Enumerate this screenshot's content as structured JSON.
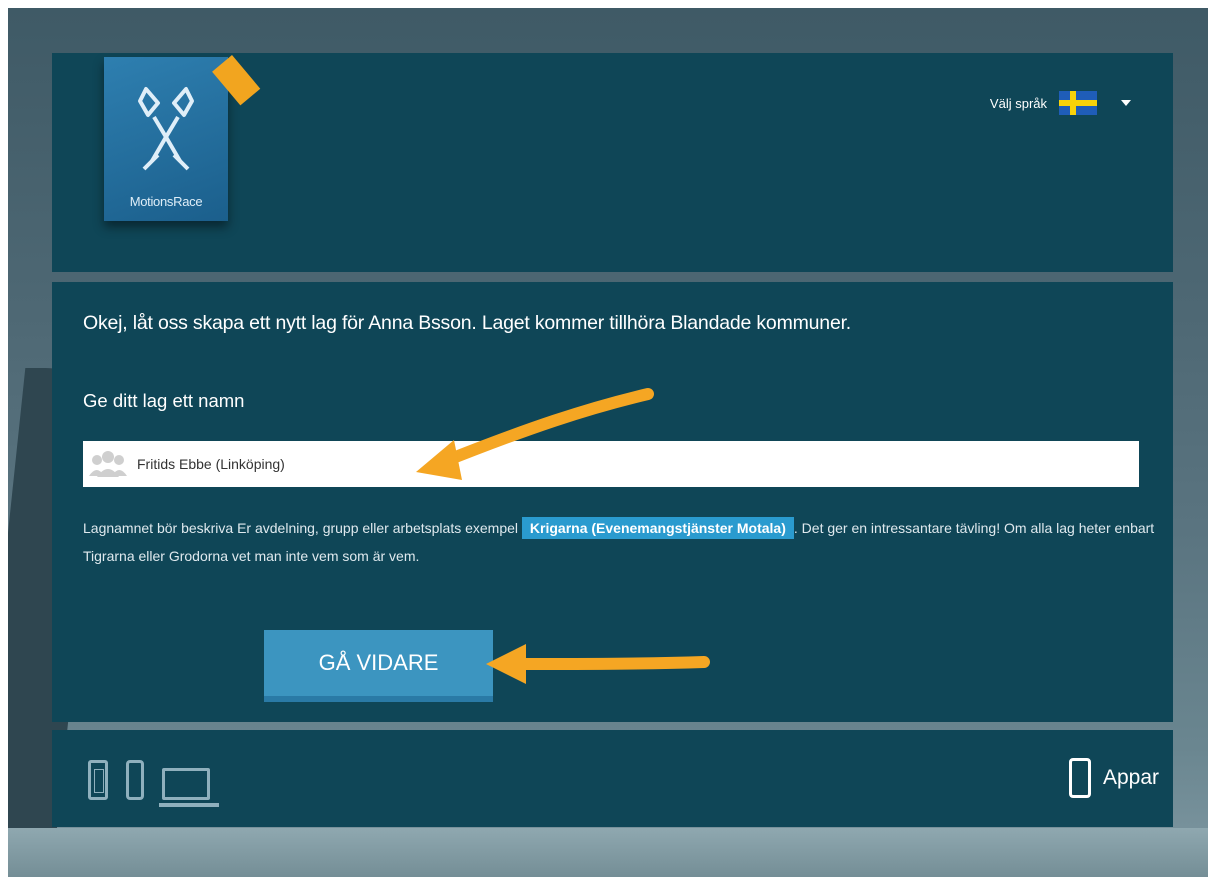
{
  "logo": {
    "text": "MotionsRace"
  },
  "language": {
    "label": "Välj språk",
    "flag_icon": "sweden-flag-icon",
    "dropdown_icon": "caret-down-icon"
  },
  "intro": "Okej, låt oss skapa ett nytt lag för Anna Bsson. Laget kommer tillhöra Blandade kommuner.",
  "team_name": {
    "label": "Ge ditt lag ett namn",
    "value": "Fritids Ebbe (Linköping)",
    "icon": "group-icon"
  },
  "hint": {
    "prefix": "Lagnamnet bör beskriva Er avdelning, grupp eller arbetsplats exempel",
    "example": "Krigarna (Evenemangstjänster Motala)",
    "suffix": ". Det ger en intressantare tävling! Om alla lag heter enbart Tigrarna eller Grodorna vet man inte vem som är vem."
  },
  "continue_button": "GÅ VIDARE",
  "footer": {
    "devices": [
      "phone-icon",
      "mobile-icon",
      "laptop-icon"
    ],
    "apps_label": "Appar",
    "apps_icon": "smartphone-icon"
  },
  "colors": {
    "panel": "#0f4657",
    "button": "#3c95c0",
    "chip": "#2a9bcf",
    "arrow": "#f5a623"
  }
}
